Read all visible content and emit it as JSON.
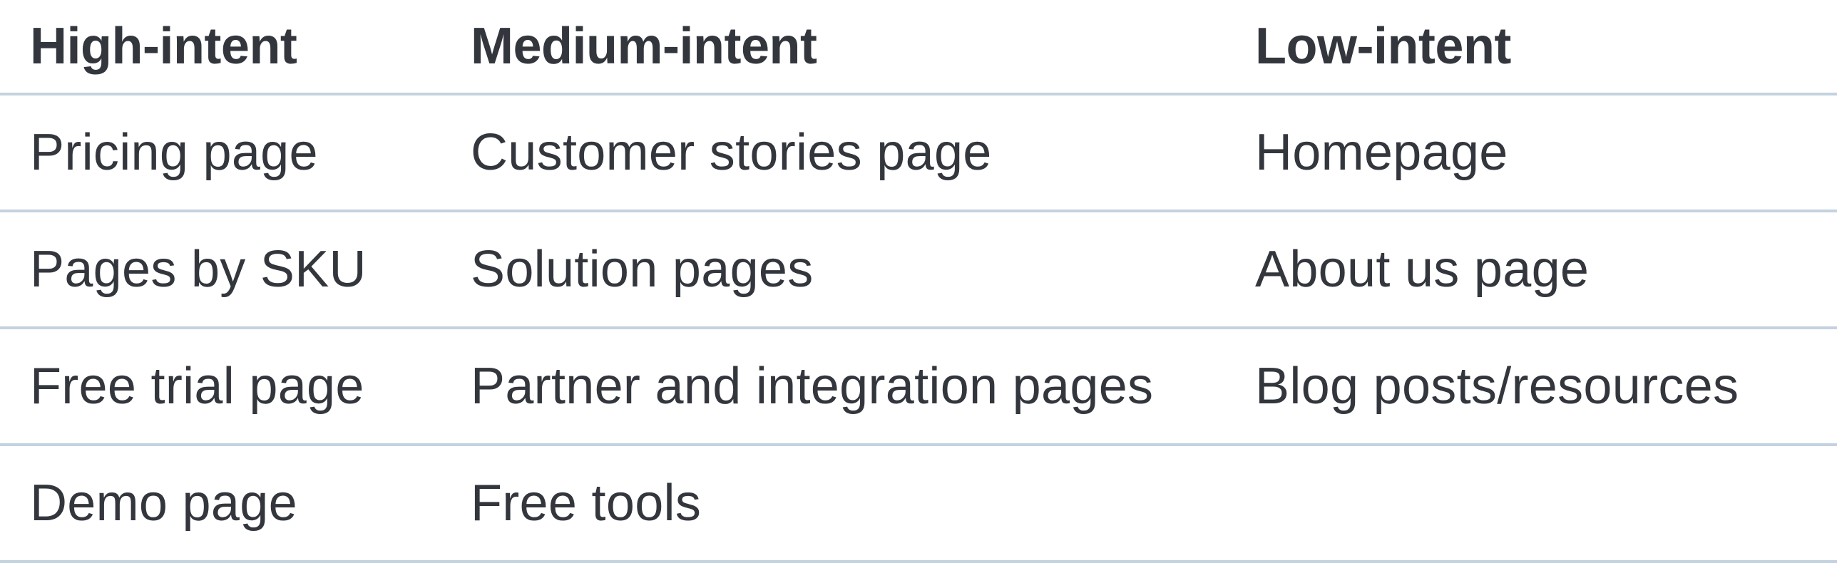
{
  "table": {
    "columns": [
      "High-intent",
      "Medium-intent",
      "Low-intent"
    ],
    "rows": [
      [
        "Pricing page",
        "Customer stories page",
        "Homepage"
      ],
      [
        "Pages by SKU",
        "Solution pages",
        "About us page"
      ],
      [
        "Free trial page",
        "Partner and integration pages",
        "Blog posts/resources"
      ],
      [
        "Demo page",
        "Free tools",
        ""
      ]
    ]
  },
  "colors": {
    "text": "#33373d",
    "divider": "#c4d2e0",
    "background": "#ffffff"
  }
}
